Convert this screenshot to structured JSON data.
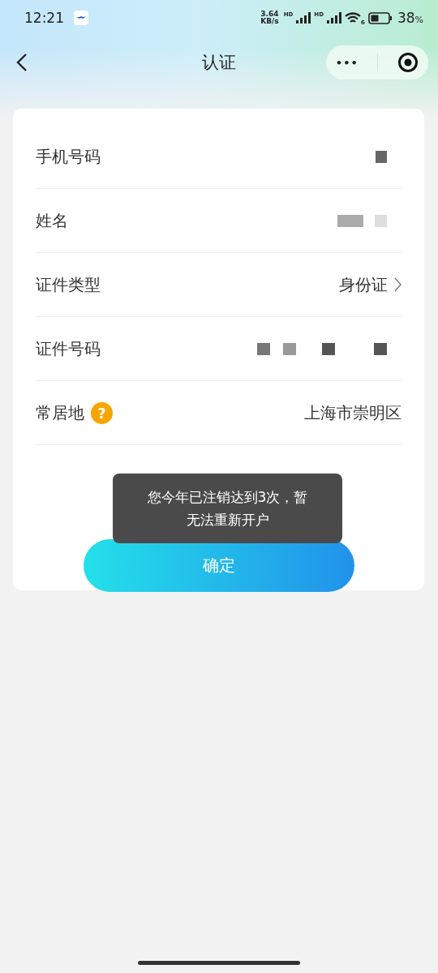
{
  "status_bar": {
    "time": "12:21",
    "speed_value": "3.64",
    "speed_unit": "KB/s",
    "signal_labels": [
      "HD",
      "HD"
    ],
    "wifi_label": "6",
    "battery_value": "38",
    "battery_unit": "%"
  },
  "nav": {
    "title": "认证",
    "more_glyph": "•••"
  },
  "form": {
    "rows": [
      {
        "label": "手机号码",
        "kind": "masked",
        "help": false
      },
      {
        "label": "姓名",
        "kind": "masked",
        "help": false
      },
      {
        "label": "证件类型",
        "kind": "select",
        "value": "身份证",
        "help": false
      },
      {
        "label": "证件号码",
        "kind": "masked",
        "help": false
      },
      {
        "label": "常居地",
        "kind": "text",
        "value": "上海市崇明区",
        "help": true,
        "help_glyph": "?"
      }
    ]
  },
  "confirm_button": "确定",
  "toast": "您今年已注销达到3次，暂无法重新开户"
}
